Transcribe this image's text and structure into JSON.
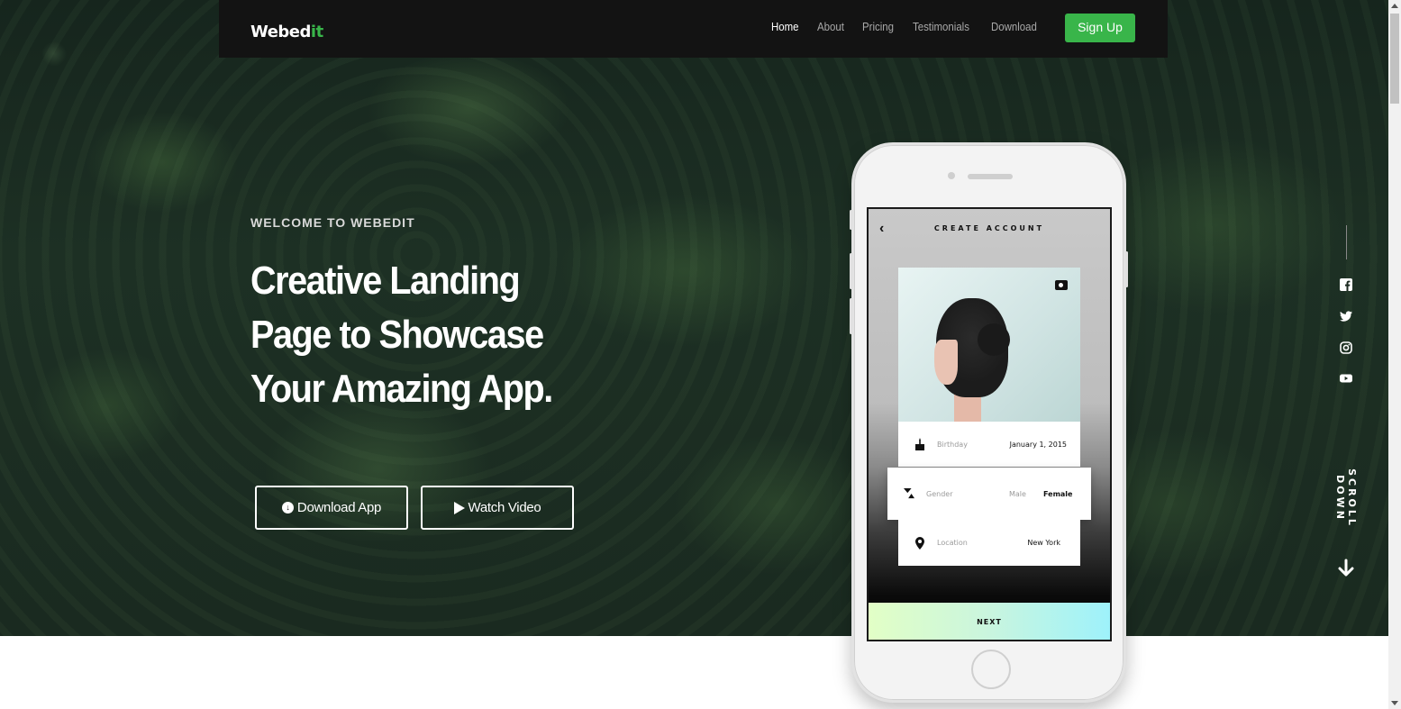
{
  "brand": {
    "logo_main": "Webed",
    "logo_accent": "it",
    "accent_color": "#39b54a"
  },
  "nav": {
    "links": [
      {
        "label": "Home",
        "active": true
      },
      {
        "label": "About",
        "active": false
      },
      {
        "label": "Pricing",
        "active": false
      },
      {
        "label": "Testimonials",
        "active": false
      },
      {
        "label": "Download",
        "active": false
      }
    ],
    "signup_label": "Sign Up"
  },
  "hero": {
    "eyebrow": "WELCOME TO WEBEDIT",
    "headline_lines": [
      "Creative Landing",
      "Page to Showcase",
      "Your Amazing App."
    ],
    "download_label": "Download App",
    "watch_label": "Watch Video"
  },
  "social": {
    "icons": [
      "facebook-icon",
      "twitter-icon",
      "instagram-icon",
      "youtube-icon"
    ],
    "scroll_label": "SCROLL DOWN"
  },
  "phone": {
    "screen_title": "CREATE ACCOUNT",
    "fields": {
      "birthday": {
        "label": "Birthday",
        "value": "January 1, 2015"
      },
      "gender": {
        "label": "Gender",
        "option_1": "Male",
        "option_2": "Female"
      },
      "location": {
        "label": "Location",
        "value": "New York"
      }
    },
    "next_label": "NEXT"
  }
}
